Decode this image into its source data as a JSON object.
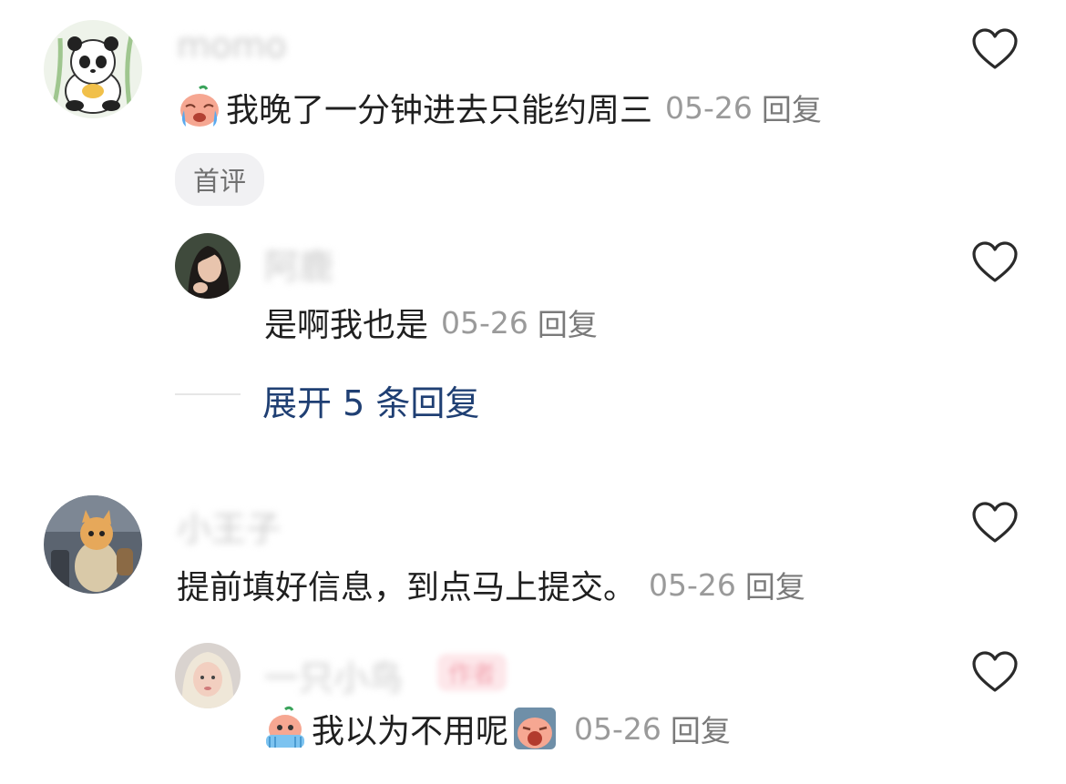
{
  "comments": [
    {
      "author": "momo",
      "emoji": "crying-emoji",
      "text": "我晚了一分钟进去只能约周三",
      "date": "05-26",
      "reply_label": "回复",
      "badge": "首评"
    },
    {
      "author": "小王子",
      "text": "提前填好信息，到点马上提交。",
      "date": "05-26",
      "reply_label": "回复"
    }
  ],
  "replies": [
    {
      "author": "阿鹿",
      "text": "是啊我也是",
      "date": "05-26",
      "reply_label": "回复"
    },
    {
      "author": "一只小鸟",
      "tag": "作者",
      "emoji_left": "hands-on-face-emoji",
      "text": "我以为不用呢",
      "emoji_right": "screaming-emoji",
      "date": "05-26",
      "reply_label": "回复"
    }
  ],
  "expand_label": "展开 5 条回复",
  "colors": {
    "expand": "#1f3f73",
    "meta": "#9a9a9a",
    "badge_bg": "#f1f1f3"
  }
}
